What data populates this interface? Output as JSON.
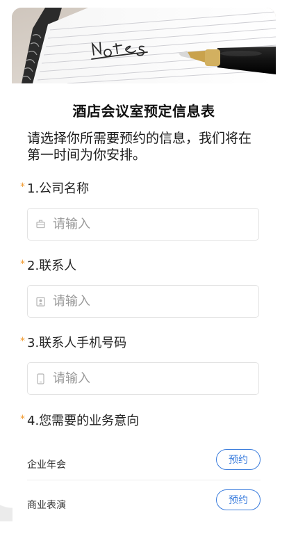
{
  "banner": {
    "image_alt": "notes-photo"
  },
  "form": {
    "title": "酒店会议室预定信息表",
    "description": "请选择你所需要预约的信息，我们将在第一时间为你安排。",
    "required_mark": "*",
    "questions": [
      {
        "label": "1.公司名称",
        "placeholder": "请输入",
        "icon": "briefcase-icon"
      },
      {
        "label": "2.联系人",
        "placeholder": "请输入",
        "icon": "contact-card-icon"
      },
      {
        "label": "3.联系人手机号码",
        "placeholder": "请输入",
        "icon": "phone-icon"
      }
    ],
    "q4": {
      "label": "4.您需要的业务意向",
      "options": [
        {
          "text": "企业年会",
          "button": "预约"
        },
        {
          "text": "商业表演",
          "button": "预约"
        }
      ]
    }
  },
  "colors": {
    "accent": "#3b7ddd",
    "required": "#f29a2e",
    "border": "#e3e3e3"
  }
}
